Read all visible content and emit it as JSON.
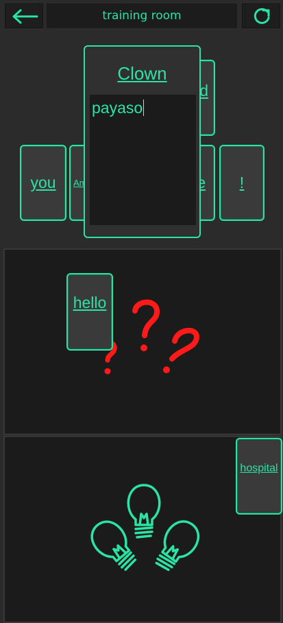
{
  "header": {
    "title": "training room",
    "back_icon": "arrow-left-icon",
    "refresh_icon": "refresh-icon"
  },
  "top_area": {
    "cards": [
      {
        "id": "you",
        "label": "you"
      },
      {
        "id": "am",
        "label": "Am"
      },
      {
        "id": "d",
        "label": "d"
      },
      {
        "id": "e",
        "label": "e"
      },
      {
        "id": "excl",
        "label": "!"
      }
    ],
    "popup": {
      "title": "Clown",
      "input_value": "payaso"
    }
  },
  "middle_panel": {
    "card_label": "hello",
    "illustration": "question-marks-icon"
  },
  "bottom_panel": {
    "card_label": "hospital",
    "illustration": "lightbulbs-icon"
  },
  "colors": {
    "accent": "#2be3a3",
    "background": "#2b2b2b",
    "panel": "#1b1b1b",
    "question_marks": "#ff1a1a"
  }
}
